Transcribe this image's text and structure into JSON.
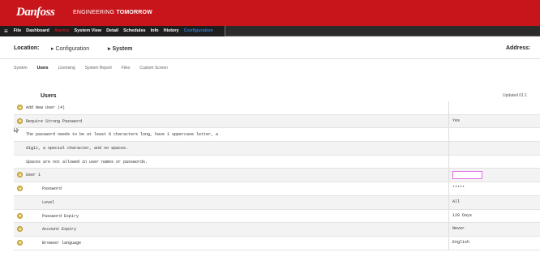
{
  "header": {
    "logo_text": "Danfoss",
    "tagline_prefix": "ENGINEERING ",
    "tagline_bold": "TOMORROW",
    "brand_color": "#c8151b"
  },
  "menu": {
    "hamburger_icon": "≡",
    "items": [
      {
        "label": "File"
      },
      {
        "label": "Dashboard"
      },
      {
        "label": "Alarms"
      },
      {
        "label": "System View"
      },
      {
        "label": "Detail"
      },
      {
        "label": "Schedules"
      },
      {
        "label": "Info"
      },
      {
        "label": "History"
      },
      {
        "label": "Configuration"
      }
    ]
  },
  "location": {
    "label": "Location:",
    "crumb1": "▸ Configuration",
    "crumb2": "▸ System",
    "address_label": "Address:"
  },
  "tabs": [
    {
      "label": "System"
    },
    {
      "label": "Users"
    },
    {
      "label": "Licensing"
    },
    {
      "label": "System Report"
    },
    {
      "label": "Files"
    },
    {
      "label": "Custom Screen"
    }
  ],
  "section": {
    "title": "Users",
    "updated": "Updated 01:1"
  },
  "rows": [
    {
      "label": "Add New User (4)",
      "value": ""
    },
    {
      "label": "Require Strong Password",
      "value": "Yes"
    },
    {
      "label": "The password needs to be at least 8 characters long, have 1 uppercase letter, a",
      "value": ""
    },
    {
      "label": "digit, a special character, and no spaces.",
      "value": ""
    },
    {
      "label": "Spaces are not allowed in user names or passwords.",
      "value": ""
    },
    {
      "label": "User 1",
      "value": ""
    },
    {
      "label": "Password",
      "value": "*****"
    },
    {
      "label": "Level",
      "value": "All"
    },
    {
      "label": "Password Expiry",
      "value": "120 Days"
    },
    {
      "label": "Account Expiry",
      "value": "Never"
    },
    {
      "label": "Browser language",
      "value": "English"
    }
  ]
}
